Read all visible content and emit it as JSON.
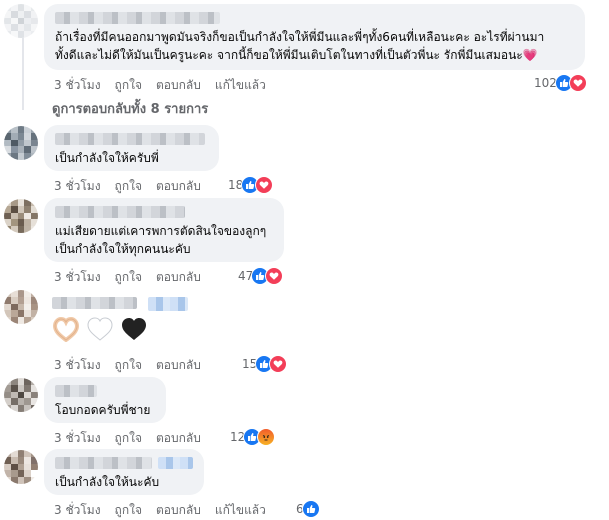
{
  "comments": [
    {
      "text_lines": [
        "ถ้าเรื่องที่มีคนออกมาพูดมันจริงก็ขอเป็นกำลังใจให้พี่มีนและพี่ๆทั้ง6คนที่เหลือนะคะ อะไรที่ผ่านมา",
        "ทั้งดีและไม่ดีให้มันเป็นครูนะคะ จากนี้ก็ขอให้พี่มีนเติบโตในทางที่เป็นตัวพี่นะ รักพี่มีนเสมอนะ💗"
      ],
      "time": "3 ชั่วโมง",
      "like": "ถูกใจ",
      "reply": "ตอบกลับ",
      "edited": "แก้ไขแล้ว",
      "reaction_count": "102",
      "reactions": [
        "like",
        "love"
      ]
    },
    {
      "text_lines": [
        "เป็นกำลังใจให้ครับพี่"
      ],
      "time": "3 ชั่วโมง",
      "like": "ถูกใจ",
      "reply": "ตอบกลับ",
      "reaction_count": "18",
      "reactions": [
        "like",
        "love"
      ]
    },
    {
      "text_lines": [
        "แม่เสียดายแต่เคารพการตัดสินใจของลูกๆ",
        "เป็นกำลังใจให้ทุกคนนะคับ"
      ],
      "time": "3 ชั่วโมง",
      "like": "ถูกใจ",
      "reply": "ตอบกลับ",
      "reaction_count": "47",
      "reactions": [
        "like",
        "love"
      ]
    },
    {
      "text_lines": [
        "🫶🏻🤍🖤"
      ],
      "time": "3 ชั่วโมง",
      "like": "ถูกใจ",
      "reply": "ตอบกลับ",
      "reaction_count": "15",
      "reactions": [
        "like",
        "love"
      ]
    },
    {
      "text_lines": [
        "โอบกอดครับพี่ชาย"
      ],
      "time": "3 ชั่วโมง",
      "like": "ถูกใจ",
      "reply": "ตอบกลับ",
      "reaction_count": "12",
      "reactions": [
        "like",
        "angry"
      ]
    },
    {
      "text_lines": [
        "เป็นกำลังใจให้นะคับ"
      ],
      "time": "3 ชั่วโมง",
      "like": "ถูกใจ",
      "reply": "ตอบกลับ",
      "edited": "แก้ไขแล้ว",
      "reaction_count": "6",
      "reactions": [
        "like"
      ]
    }
  ],
  "view_replies": "ดูการตอบกลับทั้ง 8 รายการ",
  "reaction_icons": {
    "like": "thumbs-up-icon",
    "love": "heart-icon",
    "angry": "angry-face-icon"
  },
  "colors": {
    "like": "#1877f2",
    "love": "#f33e58",
    "angry": "#f7b125",
    "bubble": "#f0f2f5",
    "meta": "#65676b"
  }
}
